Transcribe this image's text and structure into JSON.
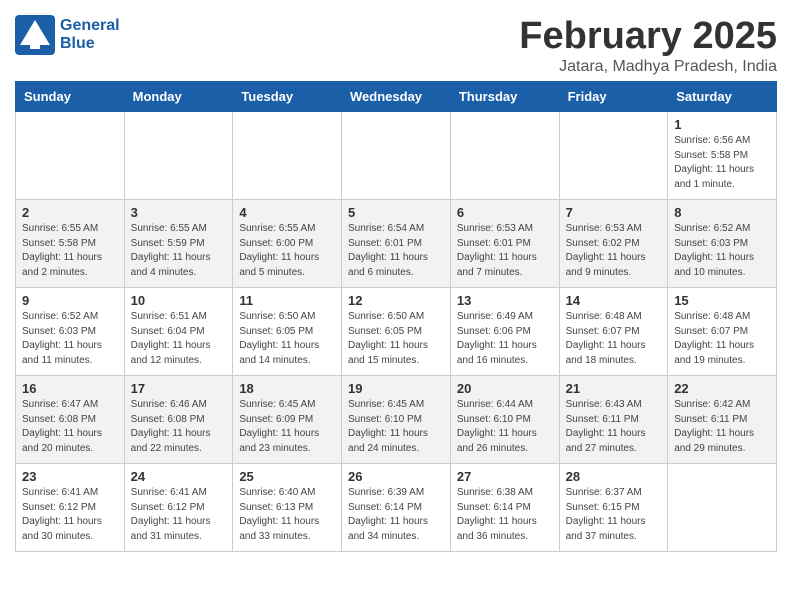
{
  "header": {
    "logo_line1": "General",
    "logo_line2": "Blue",
    "month_year": "February 2025",
    "location": "Jatara, Madhya Pradesh, India"
  },
  "days_of_week": [
    "Sunday",
    "Monday",
    "Tuesday",
    "Wednesday",
    "Thursday",
    "Friday",
    "Saturday"
  ],
  "weeks": [
    [
      {
        "day": "",
        "info": ""
      },
      {
        "day": "",
        "info": ""
      },
      {
        "day": "",
        "info": ""
      },
      {
        "day": "",
        "info": ""
      },
      {
        "day": "",
        "info": ""
      },
      {
        "day": "",
        "info": ""
      },
      {
        "day": "1",
        "info": "Sunrise: 6:56 AM\nSunset: 5:58 PM\nDaylight: 11 hours and 1 minute."
      }
    ],
    [
      {
        "day": "2",
        "info": "Sunrise: 6:55 AM\nSunset: 5:58 PM\nDaylight: 11 hours and 2 minutes."
      },
      {
        "day": "3",
        "info": "Sunrise: 6:55 AM\nSunset: 5:59 PM\nDaylight: 11 hours and 4 minutes."
      },
      {
        "day": "4",
        "info": "Sunrise: 6:55 AM\nSunset: 6:00 PM\nDaylight: 11 hours and 5 minutes."
      },
      {
        "day": "5",
        "info": "Sunrise: 6:54 AM\nSunset: 6:01 PM\nDaylight: 11 hours and 6 minutes."
      },
      {
        "day": "6",
        "info": "Sunrise: 6:53 AM\nSunset: 6:01 PM\nDaylight: 11 hours and 7 minutes."
      },
      {
        "day": "7",
        "info": "Sunrise: 6:53 AM\nSunset: 6:02 PM\nDaylight: 11 hours and 9 minutes."
      },
      {
        "day": "8",
        "info": "Sunrise: 6:52 AM\nSunset: 6:03 PM\nDaylight: 11 hours and 10 minutes."
      }
    ],
    [
      {
        "day": "9",
        "info": "Sunrise: 6:52 AM\nSunset: 6:03 PM\nDaylight: 11 hours and 11 minutes."
      },
      {
        "day": "10",
        "info": "Sunrise: 6:51 AM\nSunset: 6:04 PM\nDaylight: 11 hours and 12 minutes."
      },
      {
        "day": "11",
        "info": "Sunrise: 6:50 AM\nSunset: 6:05 PM\nDaylight: 11 hours and 14 minutes."
      },
      {
        "day": "12",
        "info": "Sunrise: 6:50 AM\nSunset: 6:05 PM\nDaylight: 11 hours and 15 minutes."
      },
      {
        "day": "13",
        "info": "Sunrise: 6:49 AM\nSunset: 6:06 PM\nDaylight: 11 hours and 16 minutes."
      },
      {
        "day": "14",
        "info": "Sunrise: 6:48 AM\nSunset: 6:07 PM\nDaylight: 11 hours and 18 minutes."
      },
      {
        "day": "15",
        "info": "Sunrise: 6:48 AM\nSunset: 6:07 PM\nDaylight: 11 hours and 19 minutes."
      }
    ],
    [
      {
        "day": "16",
        "info": "Sunrise: 6:47 AM\nSunset: 6:08 PM\nDaylight: 11 hours and 20 minutes."
      },
      {
        "day": "17",
        "info": "Sunrise: 6:46 AM\nSunset: 6:08 PM\nDaylight: 11 hours and 22 minutes."
      },
      {
        "day": "18",
        "info": "Sunrise: 6:45 AM\nSunset: 6:09 PM\nDaylight: 11 hours and 23 minutes."
      },
      {
        "day": "19",
        "info": "Sunrise: 6:45 AM\nSunset: 6:10 PM\nDaylight: 11 hours and 24 minutes."
      },
      {
        "day": "20",
        "info": "Sunrise: 6:44 AM\nSunset: 6:10 PM\nDaylight: 11 hours and 26 minutes."
      },
      {
        "day": "21",
        "info": "Sunrise: 6:43 AM\nSunset: 6:11 PM\nDaylight: 11 hours and 27 minutes."
      },
      {
        "day": "22",
        "info": "Sunrise: 6:42 AM\nSunset: 6:11 PM\nDaylight: 11 hours and 29 minutes."
      }
    ],
    [
      {
        "day": "23",
        "info": "Sunrise: 6:41 AM\nSunset: 6:12 PM\nDaylight: 11 hours and 30 minutes."
      },
      {
        "day": "24",
        "info": "Sunrise: 6:41 AM\nSunset: 6:12 PM\nDaylight: 11 hours and 31 minutes."
      },
      {
        "day": "25",
        "info": "Sunrise: 6:40 AM\nSunset: 6:13 PM\nDaylight: 11 hours and 33 minutes."
      },
      {
        "day": "26",
        "info": "Sunrise: 6:39 AM\nSunset: 6:14 PM\nDaylight: 11 hours and 34 minutes."
      },
      {
        "day": "27",
        "info": "Sunrise: 6:38 AM\nSunset: 6:14 PM\nDaylight: 11 hours and 36 minutes."
      },
      {
        "day": "28",
        "info": "Sunrise: 6:37 AM\nSunset: 6:15 PM\nDaylight: 11 hours and 37 minutes."
      },
      {
        "day": "",
        "info": ""
      }
    ]
  ]
}
